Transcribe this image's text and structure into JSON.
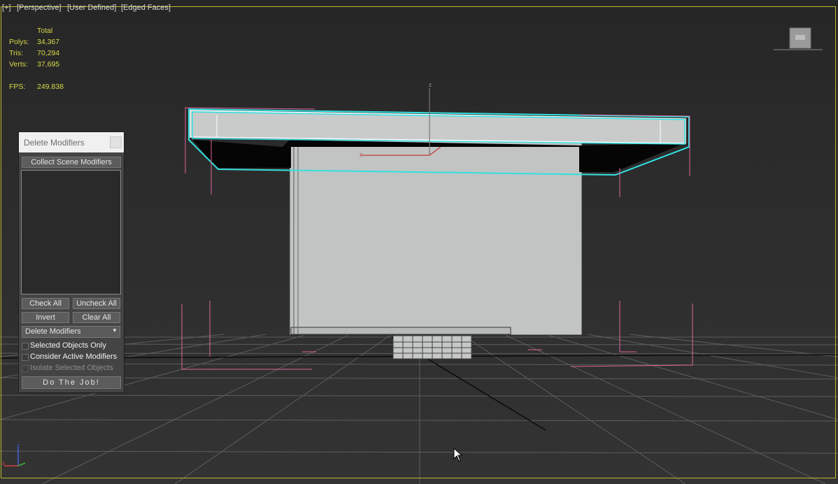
{
  "viewport": {
    "labels": [
      "[+]",
      "[Perspective]",
      "[User Defined]",
      "[Edged Faces]"
    ],
    "stats": {
      "header": "Total",
      "rows": [
        {
          "label": "Polys:",
          "value": "34,367"
        },
        {
          "label": "Tris:",
          "value": "70,294"
        },
        {
          "label": "Verts:",
          "value": "37,695"
        }
      ],
      "fps_label": "FPS:",
      "fps_value": "249.838"
    },
    "axis_labels": {
      "z": "z",
      "x": "x"
    },
    "nav_cube_icon": "viewcube-icon",
    "tripod": {
      "z": "z",
      "x": "x"
    }
  },
  "dialog": {
    "title": "Delete Modifiers",
    "collect_button": "Collect Scene Modifiers",
    "check_all": "Check All",
    "uncheck_all": "Uncheck All",
    "invert": "Invert",
    "clear_all": "Clear All",
    "dropdown_selected": "Delete Modifiers",
    "dropdown_arrow": "▼",
    "checkboxes": [
      {
        "label": "Selected Objects Only",
        "checked": false,
        "enabled": true
      },
      {
        "label": "Consider Active Modifiers",
        "checked": false,
        "enabled": true
      },
      {
        "label": "Isolate Selected Objects",
        "checked": false,
        "enabled": false
      }
    ],
    "do_job": "Do The Job!"
  },
  "colors": {
    "viewport_border": "#b9b92e",
    "stats_text": "#d9d94a",
    "selection_bracket": "#e0639b",
    "highlight": "#33e0e0",
    "object_fill": "#c2c4c4"
  }
}
